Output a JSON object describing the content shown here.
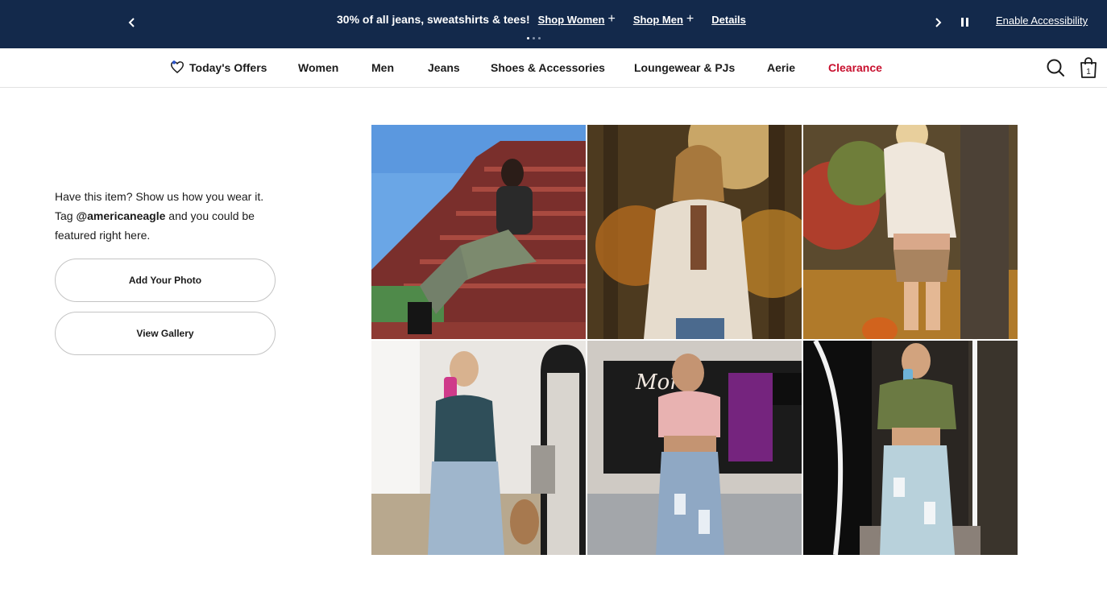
{
  "promo": {
    "message": "30% of all jeans, sweatshirts & tees!",
    "shop_women": "Shop Women",
    "shop_men": "Shop Men",
    "details": "Details",
    "accessibility": "Enable Accessibility",
    "slide_count": 3,
    "active_slide": 1,
    "background_color": "#13294b"
  },
  "nav": {
    "items": [
      {
        "label": "Today's Offers",
        "icon": "heart-tag-icon"
      },
      {
        "label": "Women"
      },
      {
        "label": "Men"
      },
      {
        "label": "Jeans"
      },
      {
        "label": "Shoes & Accessories"
      },
      {
        "label": "Loungewear & PJs"
      },
      {
        "label": "Aerie"
      },
      {
        "label": "Clearance",
        "color": "#c8102e"
      }
    ],
    "bag_count": "1"
  },
  "ugc": {
    "text_before": "Have this item? Show us how you wear it. Tag ",
    "handle": "@americaneagle",
    "text_after": " and you could be featured right here.",
    "add_photo_label": "Add Your Photo",
    "view_gallery_label": "View Gallery"
  },
  "gallery": {
    "photos": [
      {
        "subject": "woman in olive cargo pants on red wooden stairs"
      },
      {
        "subject": "woman in cream sherpa shacket in autumn woods"
      },
      {
        "subject": "woman in white sweater and tan mini skirt by tree"
      },
      {
        "subject": "mirror selfie in teal tank and ripped jeans"
      },
      {
        "subject": "woman in tie-dye crop top and ripped jeans"
      },
      {
        "subject": "mirror selfie in green cardigan and light ripped jeans"
      }
    ]
  }
}
